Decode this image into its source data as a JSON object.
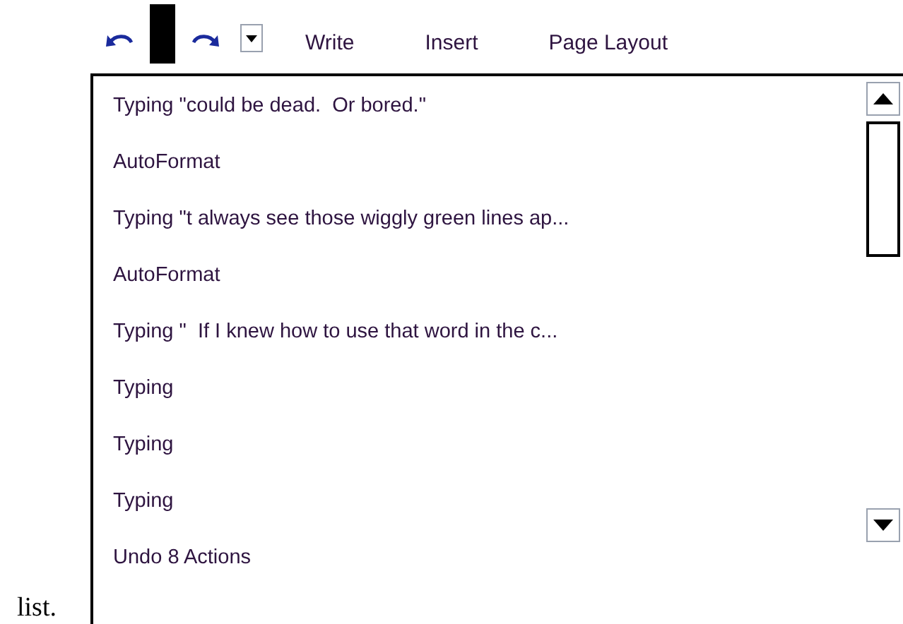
{
  "toolbar": {
    "menu": [
      "Write",
      "Insert",
      "Page Layout"
    ]
  },
  "undo_list": {
    "items": [
      "Typing \"could be dead.  Or bored.\"",
      "AutoFormat",
      "Typing \"t always see those wiggly green lines ap...",
      "AutoFormat",
      "Typing \"  If I knew how to use that word in the c...",
      "Typing",
      "Typing",
      "Typing"
    ],
    "footer": "Undo 8 Actions"
  },
  "document": {
    "text": "list."
  }
}
